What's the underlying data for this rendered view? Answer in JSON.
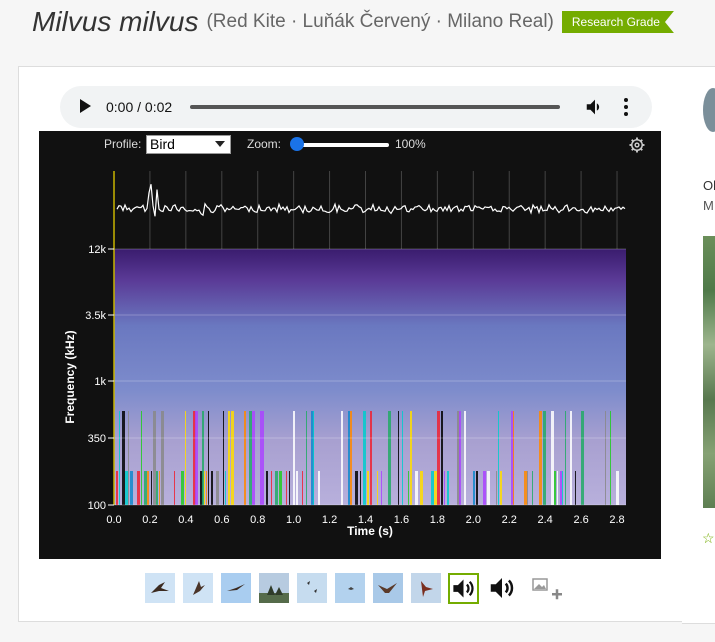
{
  "header": {
    "scientific_name": "Milvus milvus",
    "common_names": "(Red Kite · Luňák Červený · Milano Real)",
    "quality_badge": "Research Grade"
  },
  "audio_player": {
    "time_display": "0:00 / 0:02",
    "progress": 0
  },
  "spectrogram": {
    "profile_label": "Profile:",
    "profile_value": "Bird",
    "zoom_label": "Zoom:",
    "zoom_value": "100%",
    "y_axis_label": "Frequency (kHz)",
    "x_axis_label": "Time (s)",
    "y_ticks": [
      "12k",
      "3.5k",
      "1k",
      "350",
      "100"
    ],
    "x_ticks": [
      "0.0",
      "0.2",
      "0.4",
      "0.6",
      "0.8",
      "1.0",
      "1.2",
      "1.4",
      "1.6",
      "1.8",
      "2.0",
      "2.2",
      "2.4",
      "2.6",
      "2.8"
    ]
  },
  "thumbnails": [
    {
      "icon": "bird-photo-icon"
    },
    {
      "icon": "bird-photo-icon"
    },
    {
      "icon": "bird-photo-icon"
    },
    {
      "icon": "bird-photo-icon"
    },
    {
      "icon": "bird-photo-icon"
    },
    {
      "icon": "bird-photo-icon"
    },
    {
      "icon": "bird-photo-icon"
    },
    {
      "icon": "bird-photo-icon"
    },
    {
      "icon": "sound-icon",
      "selected": true
    },
    {
      "icon": "sound-icon"
    },
    {
      "icon": "add-image-icon"
    }
  ],
  "right_panel": {
    "line1": "Ol",
    "line2": "M"
  },
  "colors": {
    "accent": "#74ac00",
    "spectrogram_bg": "#111111"
  }
}
